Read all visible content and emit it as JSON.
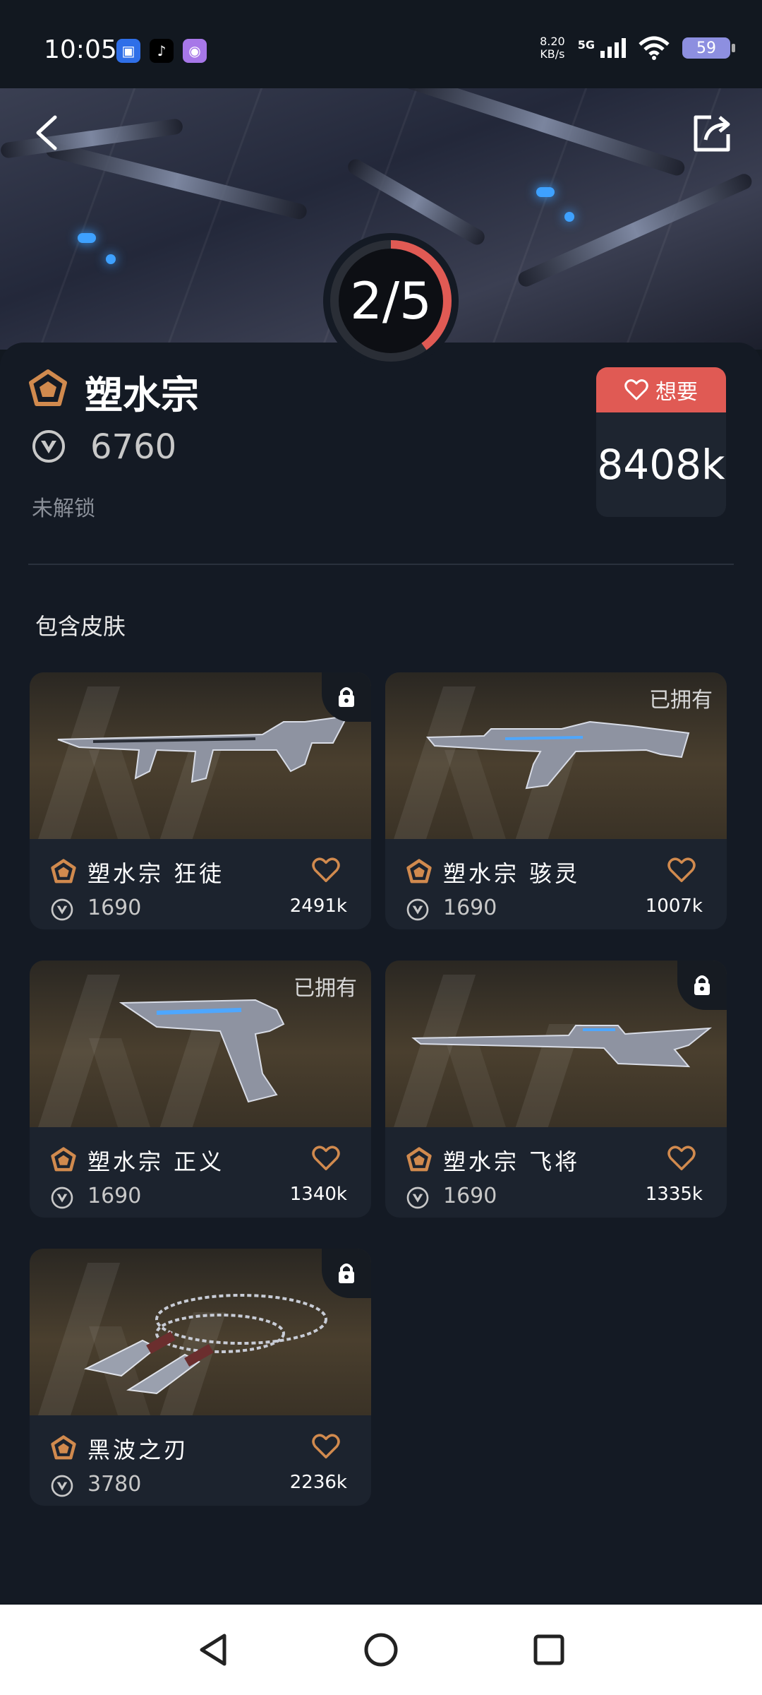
{
  "status_bar": {
    "time": "10:05",
    "net_speed_value": "8.20",
    "net_speed_unit": "KB/s",
    "network": "5G",
    "battery": "59"
  },
  "header": {
    "progress_text": "2/5",
    "progress_fraction": 0.4
  },
  "bundle": {
    "name": "塑水宗",
    "price": "6760",
    "status": "未解锁",
    "want_label": "想要",
    "want_count": "8408k"
  },
  "section": {
    "title": "包含皮肤"
  },
  "skins": [
    {
      "name": "塑水宗 狂徒",
      "price": "1690",
      "likes": "2491k",
      "locked": true,
      "owned_label": ""
    },
    {
      "name": "塑水宗 骇灵",
      "price": "1690",
      "likes": "1007k",
      "locked": false,
      "owned_label": "已拥有"
    },
    {
      "name": "塑水宗 正义",
      "price": "1690",
      "likes": "1340k",
      "locked": false,
      "owned_label": "已拥有"
    },
    {
      "name": "塑水宗 飞将",
      "price": "1690",
      "likes": "1335k",
      "locked": true,
      "owned_label": ""
    },
    {
      "name": "黑波之刃",
      "price": "3780",
      "likes": "2236k",
      "locked": true,
      "owned_label": ""
    }
  ],
  "colors": {
    "accent": "#e05a54",
    "tier_icon": "#d18a4e",
    "background": "#121820"
  }
}
